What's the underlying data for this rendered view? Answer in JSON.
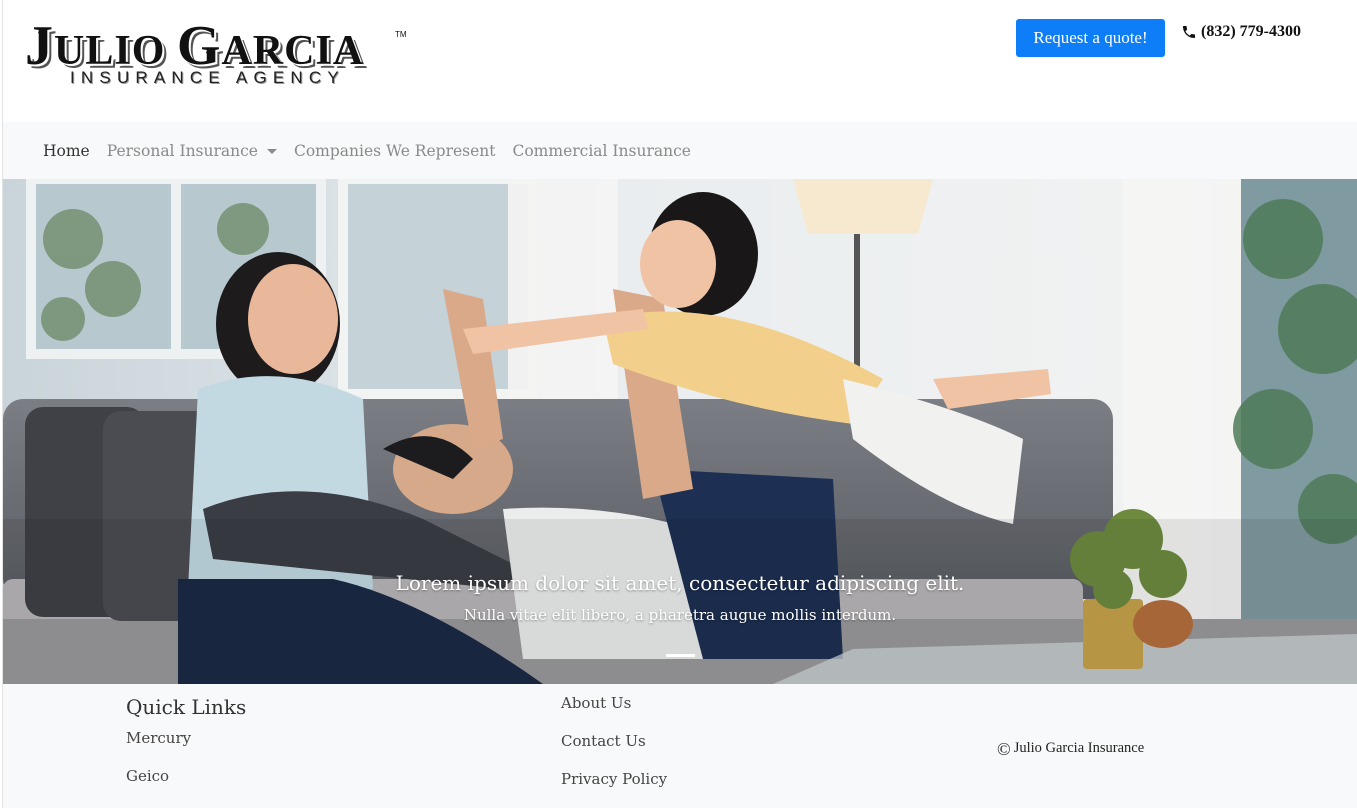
{
  "brand": {
    "logo_main_1": "J",
    "logo_main_2": "ULIO ",
    "logo_main_3": "G",
    "logo_main_4": "ARCIA",
    "logo_tm": "TM",
    "logo_sub": "INSURANCE AGENCY"
  },
  "header": {
    "quote_button": "Request a quote!",
    "phone": "(832) 779-4300"
  },
  "nav": {
    "items": [
      {
        "label": "Home"
      },
      {
        "label": "Personal Insurance"
      },
      {
        "label": "Companies We Represent"
      },
      {
        "label": "Commercial Insurance"
      }
    ]
  },
  "hero": {
    "caption_title": "Lorem ipsum dolor sit amet, consectetur adipiscing elit.",
    "caption_text": "Nulla vitae elit libero, a pharetra augue mollis interdum."
  },
  "footer": {
    "quick_links_title": "Quick Links",
    "col1": [
      "Mercury",
      "Geico"
    ],
    "col2": [
      "About Us",
      "Contact Us",
      "Privacy Policy"
    ],
    "copyright_symbol": "©",
    "copyright": "Julio Garcia Insurance"
  },
  "colors": {
    "accent": "#0d7ef8",
    "nav_bg": "#f8f9fa",
    "footer_bg": "#f8f9fa"
  }
}
